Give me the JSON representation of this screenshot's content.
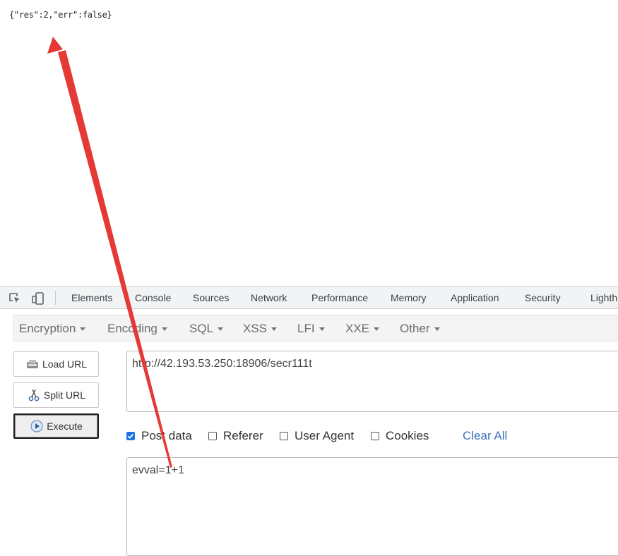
{
  "page": {
    "response_text": "{\"res\":2,\"err\":false}"
  },
  "devtools": {
    "tabs": [
      "Elements",
      "Console",
      "Sources",
      "Network",
      "Performance",
      "Memory",
      "Application",
      "Security",
      "Lighth"
    ],
    "icons": [
      "inspect-element-icon",
      "device-toggle-icon"
    ]
  },
  "hackbar": {
    "menu": [
      "Encryption",
      "Encoding",
      "SQL",
      "XSS",
      "LFI",
      "XXE",
      "Other"
    ],
    "buttons": {
      "load_url": "Load URL",
      "split_url": "Split URL",
      "execute": "Execute"
    },
    "url_value": "http://42.193.53.250:18906/secr111t",
    "options": {
      "post_data": {
        "label": "Post data",
        "checked": true
      },
      "referer": {
        "label": "Referer",
        "checked": false
      },
      "user_agent": {
        "label": "User Agent",
        "checked": false
      },
      "cookies": {
        "label": "Cookies",
        "checked": false
      }
    },
    "clear_all": "Clear All",
    "post_body": "evval=1+1"
  },
  "colors": {
    "annotation": "#e53935",
    "link": "#3b73b9",
    "checkbox_on": "#1a73e8"
  }
}
